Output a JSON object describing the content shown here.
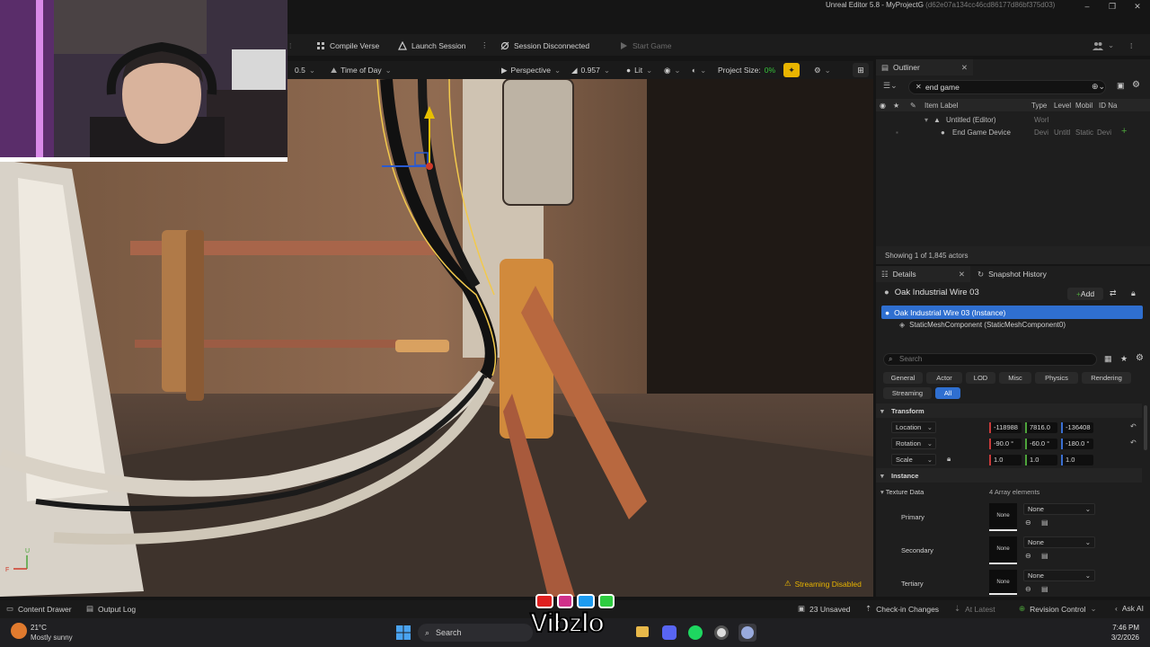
{
  "window": {
    "title": "Unreal Editor 5.8 - MyProjectG",
    "hash": "(d62e07a134cc46cd86177d86bf375d03)"
  },
  "toolbar": {
    "compile_verse": "Compile Verse",
    "launch_session": "Launch Session",
    "session_status": "Session Disconnected",
    "start_game": "Start Game"
  },
  "viewport_toolbar": {
    "speed": "0.5",
    "time_of_day": "Time of Day",
    "perspective": "Perspective",
    "fov": "0.957",
    "lit": "Lit",
    "project_size_label": "Project Size:",
    "project_size_value": "0%",
    "streaming_warning": "Streaming Disabled"
  },
  "outliner": {
    "tab_label": "Outliner",
    "search_value": "end game",
    "columns": {
      "item_label": "Item Label",
      "type": "Type",
      "level": "Level",
      "mobility": "Mobil",
      "id_name": "ID Na"
    },
    "rows": [
      {
        "label": "Untitled (Editor)",
        "type": "Worl"
      },
      {
        "label": "End Game Device",
        "type": "Devi",
        "level": "Untitl",
        "mobility": "Static",
        "id_name": "Devi"
      }
    ],
    "footer": "Showing 1 of 1,845 actors"
  },
  "details": {
    "tab_label": "Details",
    "snapshot_tab": "Snapshot History",
    "actor_name": "Oak Industrial Wire 03",
    "add_label": "Add",
    "instance_label": "Oak Industrial Wire 03 (Instance)",
    "component_label": "StaticMeshComponent (StaticMeshComponent0)",
    "search_placeholder": "Search",
    "filters": [
      "General",
      "Actor",
      "LOD",
      "Misc",
      "Physics",
      "Rendering",
      "Streaming",
      "All"
    ],
    "transform_header": "Transform",
    "location": {
      "label": "Location",
      "x": "-118988",
      "y": "7816.0",
      "z": "-136408"
    },
    "rotation": {
      "label": "Rotation",
      "x": "-90.0 °",
      "y": "-60.0 °",
      "z": "-180.0 °"
    },
    "scale": {
      "label": "Scale",
      "x": "1.0",
      "y": "1.0",
      "z": "1.0"
    },
    "instance_header": "Instance",
    "texture_data_label": "Texture Data",
    "texture_data_count": "4 Array elements",
    "textures": [
      {
        "label": "Primary",
        "thumb": "None",
        "value": "None"
      },
      {
        "label": "Secondary",
        "thumb": "None",
        "value": "None"
      },
      {
        "label": "Tertiary",
        "thumb": "None",
        "value": "None"
      }
    ]
  },
  "statusbar": {
    "content_drawer": "Content Drawer",
    "output_log": "Output Log",
    "unsaved": "23 Unsaved",
    "check_in": "Check-in Changes",
    "at_latest": "At Latest",
    "revision_control": "Revision Control",
    "ask_ai": "Ask AI"
  },
  "taskbar": {
    "temperature": "21°C",
    "weather": "Mostly sunny",
    "search": "Search",
    "time": "7:46 PM",
    "date": "3/2/2026"
  },
  "watermark": {
    "text": "Vibzlo"
  },
  "colors": {
    "accent_blue": "#2f6fd0",
    "warning_yellow": "#e8b400",
    "project_size_green": "#35c43a",
    "selection_outline": "#f2c94c"
  }
}
